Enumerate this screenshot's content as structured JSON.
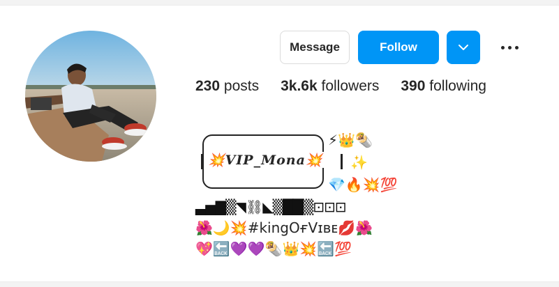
{
  "buttons": {
    "message": "Message",
    "follow": "Follow"
  },
  "stats": {
    "posts_count": "230",
    "posts_label": "posts",
    "followers_count": "3k.6k",
    "followers_label": "followers",
    "following_count": "390",
    "following_label": "following"
  },
  "bio": {
    "frame_emojis_right_1": "⚡👑🌯",
    "frame_emojis_right_2": "✨",
    "frame_emojis_right_3": "💎🔥💥💯",
    "name": "💥VIP_Mona💥",
    "blocks_line": "▃▅▇▒◥⛓◣▒██▒⊡⊡⊡",
    "line_4_left": "🌺🌙💥",
    "hashtag": "#kingOғVɪʙᴇ",
    "line_4_right": "💋🌺",
    "line_5": "💖🔙💜💜🌯👑💥🔙💯"
  },
  "icons": {
    "avatar": "profile-photo",
    "dropdown": "chevron-down-icon",
    "options": "more-options-icon"
  },
  "colors": {
    "primary": "#0095f6",
    "text": "#262626",
    "border": "#dbdbdb"
  }
}
